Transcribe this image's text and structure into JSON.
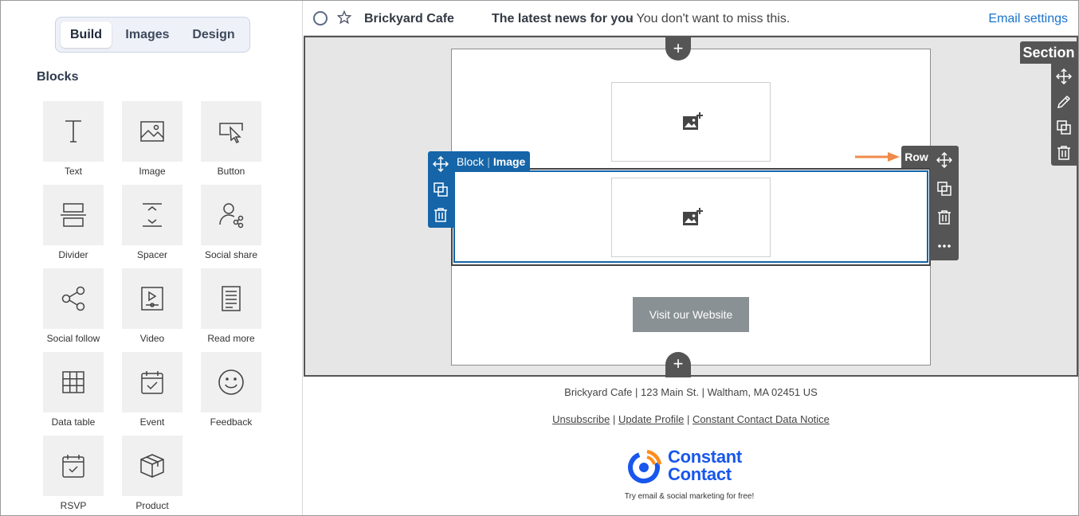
{
  "tabs": [
    {
      "label": "Build",
      "active": true
    },
    {
      "label": "Images",
      "active": false
    },
    {
      "label": "Design",
      "active": false
    }
  ],
  "blocks_heading": "Blocks",
  "blocks": [
    {
      "label": "Text",
      "icon": "text-icon"
    },
    {
      "label": "Image",
      "icon": "image-icon"
    },
    {
      "label": "Button",
      "icon": "button-icon"
    },
    {
      "label": "Divider",
      "icon": "divider-icon"
    },
    {
      "label": "Spacer",
      "icon": "spacer-icon"
    },
    {
      "label": "Social share",
      "icon": "social-share-icon"
    },
    {
      "label": "Social follow",
      "icon": "social-follow-icon"
    },
    {
      "label": "Video",
      "icon": "video-icon"
    },
    {
      "label": "Read more",
      "icon": "read-more-icon"
    },
    {
      "label": "Data table",
      "icon": "data-table-icon"
    },
    {
      "label": "Event",
      "icon": "event-icon"
    },
    {
      "label": "Feedback",
      "icon": "feedback-icon"
    },
    {
      "label": "RSVP",
      "icon": "rsvp-icon"
    },
    {
      "label": "Product",
      "icon": "product-icon"
    }
  ],
  "header": {
    "sender": "Brickyard Cafe",
    "subject": "The latest news for you",
    "preheader": " - You don't want to miss this.",
    "email_settings": "Email settings"
  },
  "canvas": {
    "section_label": "Section",
    "row_label": "Row",
    "block_label": "Block",
    "block_type": "Image",
    "add_icon": "+",
    "button_text": "Visit our Website"
  },
  "footer": {
    "address": "Brickyard Cafe | 123 Main St. | Waltham, MA 02451 US",
    "links": [
      "Unsubscribe",
      "Update Profile",
      "Constant Contact Data Notice"
    ],
    "separator": " | ",
    "logo_line1": "Constant",
    "logo_line2": "Contact",
    "tagline": "Try email & social marketing for free!"
  },
  "colors": {
    "accent_blue": "#1565a8",
    "toolbar_gray": "#555555",
    "arrow_orange": "#f08a4b",
    "link_blue": "#1a73c9",
    "logo_blue": "#1856ed",
    "logo_orange": "#ff8c1a"
  }
}
